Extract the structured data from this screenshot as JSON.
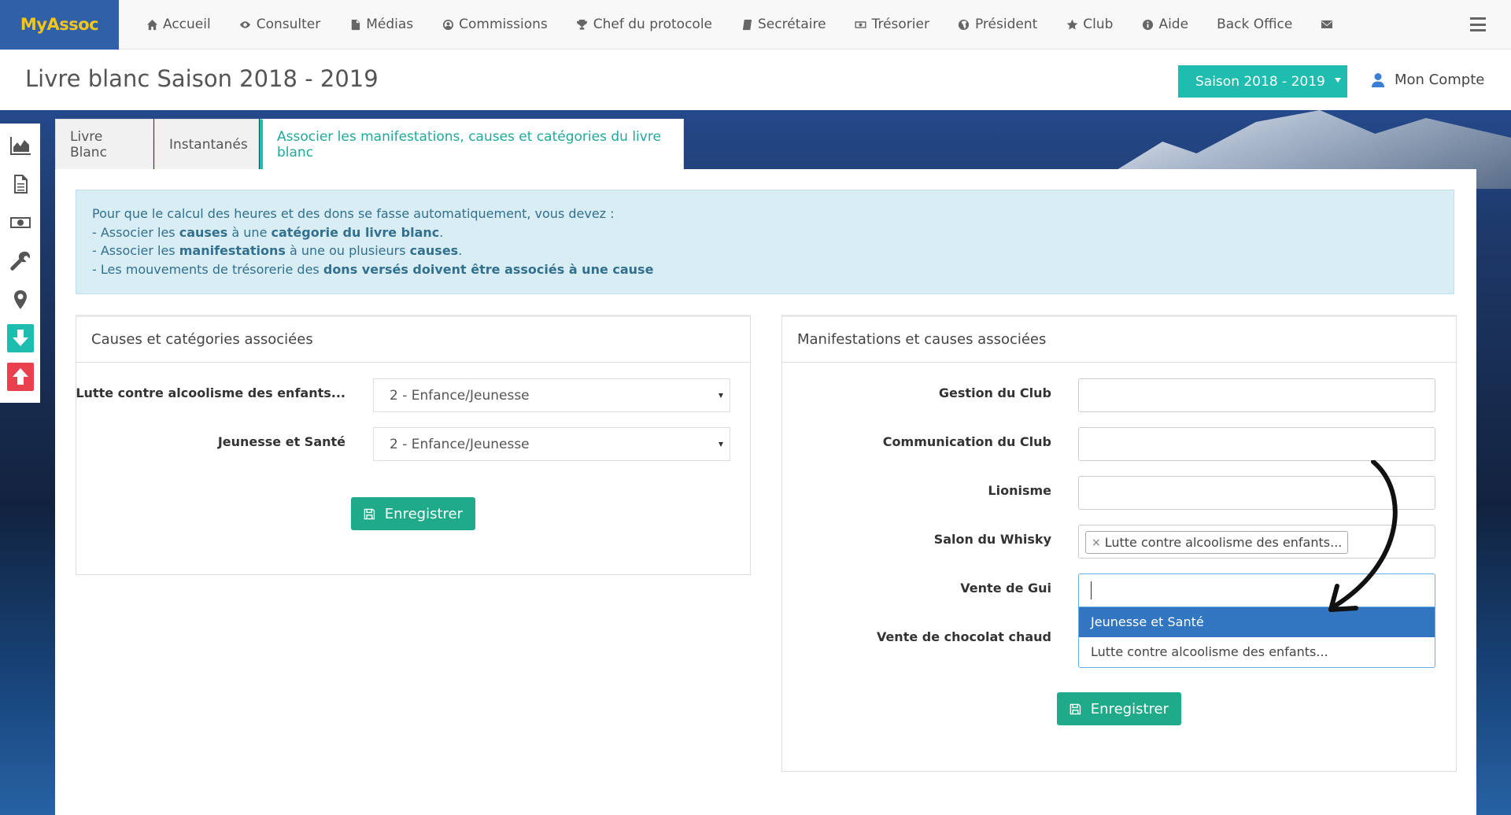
{
  "app": {
    "brand": "MyAssoc"
  },
  "nav": {
    "items": [
      {
        "label": "Accueil",
        "icon": "home-icon"
      },
      {
        "label": "Consulter",
        "icon": "eye-icon"
      },
      {
        "label": "Médias",
        "icon": "file-icon"
      },
      {
        "label": "Commissions",
        "icon": "user-circle-icon"
      },
      {
        "label": "Chef du protocole",
        "icon": "trophy-icon"
      },
      {
        "label": "Secrétaire",
        "icon": "book-icon"
      },
      {
        "label": "Trésorier",
        "icon": "money-icon"
      },
      {
        "label": "Président",
        "icon": "globe-icon"
      },
      {
        "label": "Club",
        "icon": "star-icon"
      },
      {
        "label": "Aide",
        "icon": "info-icon"
      },
      {
        "label": "Back Office",
        "icon": ""
      }
    ]
  },
  "header": {
    "title": "Livre blanc Saison 2018 - 2019",
    "season": "Saison 2018 - 2019",
    "account": "Mon Compte"
  },
  "tabs": [
    {
      "label": "Livre Blanc"
    },
    {
      "label": "Instantanés"
    },
    {
      "label": "Associer les manifestations, causes et catégories du livre blanc"
    }
  ],
  "info": {
    "intro": "Pour que le calcul des heures et des dons se fasse automatiquement, vous devez :",
    "l1_a": "- Associer les ",
    "l1_b": "causes",
    "l1_c": " à une ",
    "l1_d": "catégorie du livre blanc",
    "l1_e": ".",
    "l2_a": "- Associer les ",
    "l2_b": "manifestations",
    "l2_c": " à une ou plusieurs ",
    "l2_d": "causes",
    "l2_e": ".",
    "l3_a": "- Les mouvements de trésorerie des ",
    "l3_b": "dons versés doivent être associés à une cause"
  },
  "causes_panel": {
    "title": "Causes et catégories associées",
    "rows": [
      {
        "label": "Lutte contre alcoolisme des enfants...",
        "value": "2 - Enfance/Jeunesse"
      },
      {
        "label": "Jeunesse et Santé",
        "value": "2 - Enfance/Jeunesse"
      }
    ],
    "save": "Enregistrer"
  },
  "events_panel": {
    "title": "Manifestations et causes associées",
    "rows": [
      {
        "label": "Gestion du Club"
      },
      {
        "label": "Communication du Club"
      },
      {
        "label": "Lionisme"
      },
      {
        "label": "Salon du Whisky",
        "tag": "Lutte contre alcoolisme des enfants...",
        "tag_remove": "×"
      },
      {
        "label": "Vente de Gui"
      },
      {
        "label": "Vente de chocolat chaud"
      }
    ],
    "dropdown": [
      "Jeunesse et Santé",
      "Lutte contre alcoolisme des enfants..."
    ],
    "save": "Enregistrer"
  },
  "colors": {
    "brand": "#3060a8",
    "accent": "#1fbcb0",
    "save": "#1fab89",
    "highlight": "#3276c2"
  }
}
